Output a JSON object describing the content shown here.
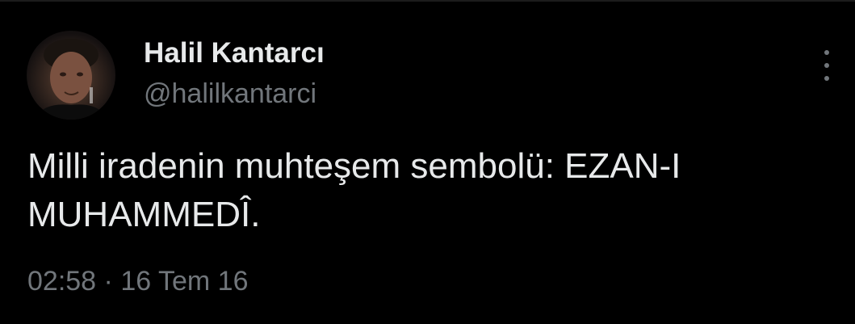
{
  "author": {
    "name": "Halil Kantarcı",
    "handle": "@halilkantarci"
  },
  "tweet": {
    "text": "Milli iradenin muhteşem sembolü: EZAN-I\nMUHAMMEDÎ.",
    "time": "02:58",
    "separator": "·",
    "date": "16 Tem 16"
  },
  "icons": {
    "more": "more-vertical-icon"
  },
  "colors": {
    "background": "#000000",
    "primary_text": "#e7e9ea",
    "secondary_text": "#71767b"
  }
}
